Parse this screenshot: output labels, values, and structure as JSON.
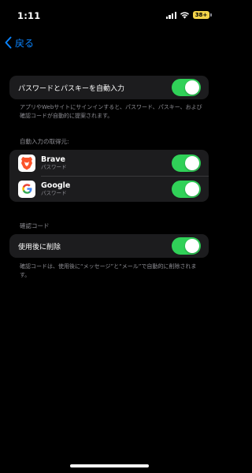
{
  "status_bar": {
    "time": "1:11",
    "battery_level": "38+",
    "battery_color": "#f2d34a"
  },
  "nav": {
    "back_label": "戻る",
    "accent_color": "#0a84ff"
  },
  "autofill": {
    "label": "パスワードとパスキーを自動入力",
    "enabled": true,
    "footer": "アプリやWebサイトにサインインすると、パスワード、パスキー、および確認コードが自動的に提案されます。"
  },
  "autofill_from": {
    "header": "自動入力の取得元:",
    "items": [
      {
        "name": "Brave",
        "subtitle": "パスワード",
        "icon": "brave-lion-icon",
        "enabled": true
      },
      {
        "name": "Google",
        "subtitle": "パスワード",
        "icon": "google-g-icon",
        "enabled": true
      }
    ]
  },
  "verification_codes": {
    "header": "確認コード",
    "label": "使用後に削除",
    "enabled": true,
    "footer": "確認コードは、使用後に“メッセージ”と“メール”で自動的に削除されます。"
  },
  "toggle_on_color": "#30d158"
}
